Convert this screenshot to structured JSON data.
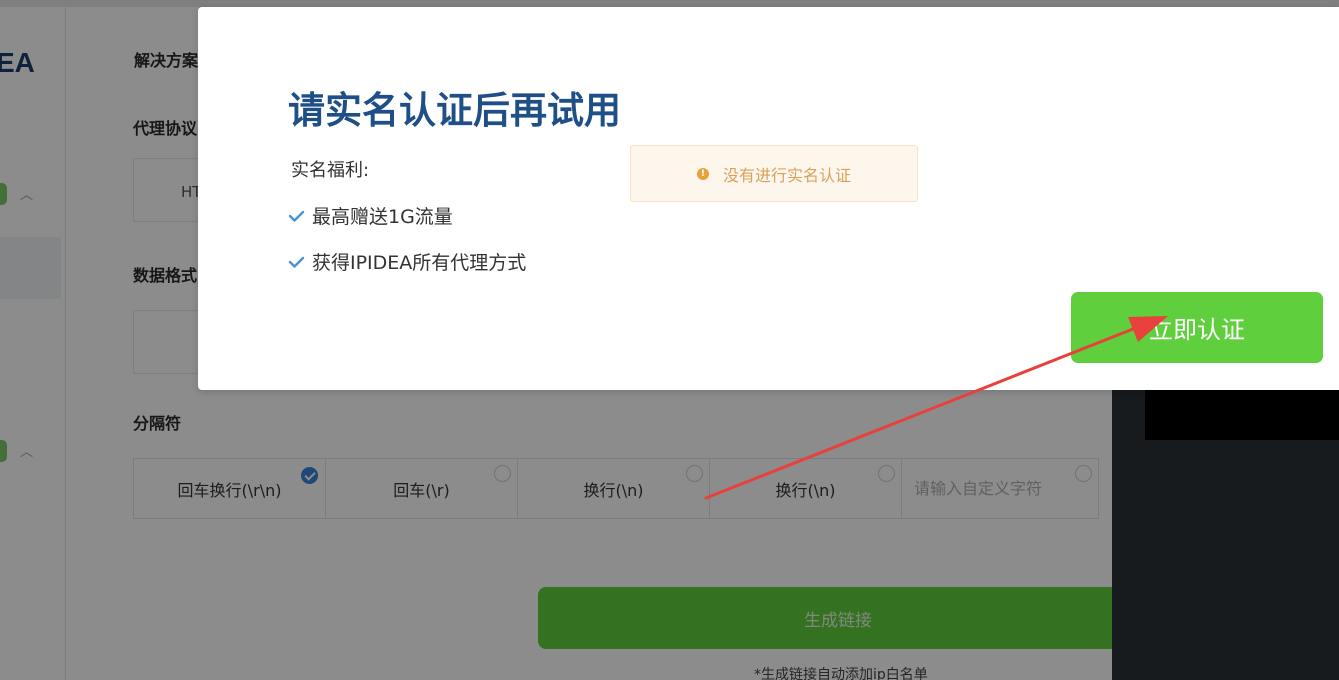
{
  "background": {
    "logo_text": "EA",
    "sections": {
      "solutions_label": "解决方案",
      "proxy_protocol_label": "代理协议",
      "protocol_value": "HT",
      "data_format_label": "数据格式",
      "separator_label": "分隔符"
    },
    "separators": [
      {
        "label": "回车换行(\\r\\n)",
        "checked": true
      },
      {
        "label": "回车(\\r)",
        "checked": false
      },
      {
        "label": "换行(\\n)",
        "checked": false
      },
      {
        "label": "换行(\\n)",
        "checked": false
      }
    ],
    "custom_separator_placeholder": "请输入自定义字符",
    "generate_button": "生成链接",
    "generate_note": "*生成链接自动添加ip白名单"
  },
  "modal": {
    "title": "请实名认证后再试用",
    "benefits_heading": "实名福利:",
    "benefits": [
      "最高赠送1G流量",
      "获得IPIDEA所有代理方式"
    ],
    "alert_text": "没有进行实名认证",
    "verify_button": "立即认证"
  },
  "colors": {
    "title": "#1e4f86",
    "accent_green": "#5fcf3d",
    "warning": "#e6a23c",
    "check": "#4a90d9",
    "annotation_arrow": "#e8413c"
  },
  "icons": [
    "check-icon",
    "warning-icon",
    "chevron-up-icon",
    "radio-checked-icon"
  ]
}
